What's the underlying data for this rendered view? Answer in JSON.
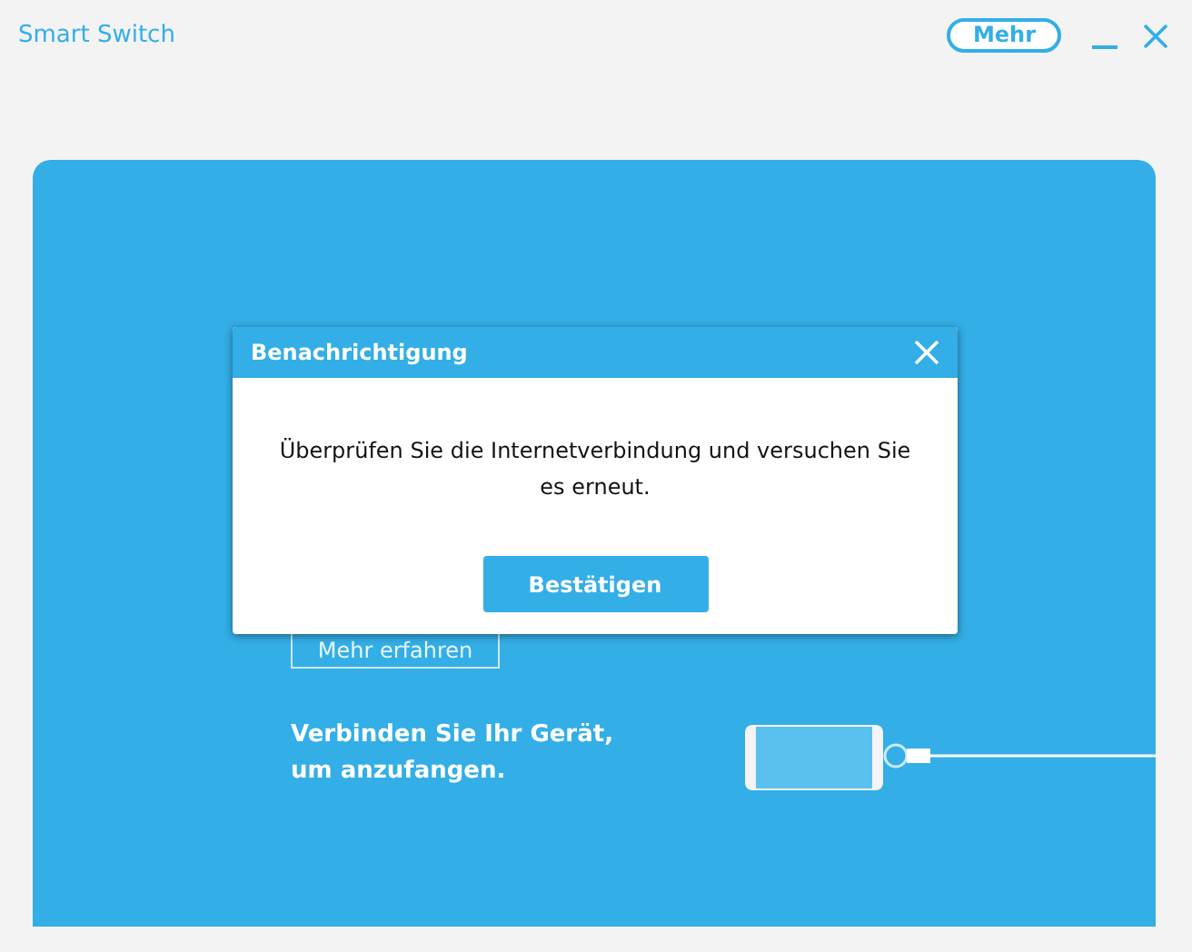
{
  "window": {
    "title": "Smart Switch",
    "more_button": "Mehr"
  },
  "panel": {
    "learn_more_button": "Mehr erfahren",
    "connect_text": "Verbinden Sie Ihr Gerät, um anzufangen."
  },
  "dialog": {
    "title": "Benachrichtigung",
    "message": "Überprüfen Sie die Internetverbindung und versuchen Sie es erneut.",
    "confirm_button": "Bestätigen"
  }
}
